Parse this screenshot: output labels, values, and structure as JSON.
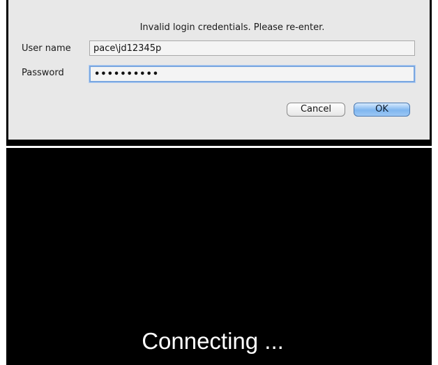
{
  "dialog": {
    "message": "Invalid login credentials. Please re-enter.",
    "username_label": "User name",
    "username_value": "pace\\jd12345p",
    "password_label": "Password",
    "password_value": "••••••••••",
    "cancel_label": "Cancel",
    "ok_label": "OK"
  },
  "remote": {
    "status_text": "Connecting ..."
  },
  "colors": {
    "dialog_background": "#e8e8e8",
    "remote_background": "#000000",
    "focus_ring": "#7aa7e0",
    "ok_button": "#7fb6ef"
  }
}
